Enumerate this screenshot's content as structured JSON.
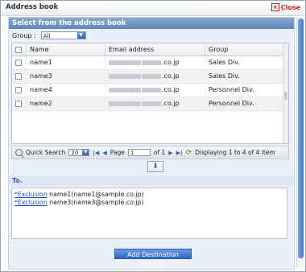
{
  "window": {
    "title": "Address book",
    "close_label": "Close"
  },
  "address_section": {
    "header": "Select from the address book"
  },
  "group": {
    "label": "Group :",
    "selected": "All"
  },
  "grid": {
    "columns": [
      "Name",
      "Email address",
      "Group"
    ],
    "rows": [
      {
        "name": "name1",
        "email_suffix": "co.jp",
        "group": "Sales Div."
      },
      {
        "name": "name3",
        "email_suffix": "co.jp",
        "group": "Sales Div."
      },
      {
        "name": "name4",
        "email_suffix": "co.jp",
        "group": "Personnel Div."
      },
      {
        "name": "name2",
        "email_suffix": "co.jp",
        "group": "Personnel Div."
      }
    ]
  },
  "pager": {
    "quick_search": "Quick Search",
    "page_size": "20",
    "page_label": "Page",
    "page_value": "1",
    "of_label": "of 1",
    "status": "Displaying 1 to 4 of 4 item"
  },
  "to_section": {
    "header": "To.",
    "entries": [
      {
        "link": "*Exclusion",
        "text": "name1(name1@sample.co.jp)"
      },
      {
        "link": "*Exclusion",
        "text": "name3(name3@sample.co.jp)"
      }
    ]
  },
  "add_button": {
    "label": "Add Destination address"
  }
}
